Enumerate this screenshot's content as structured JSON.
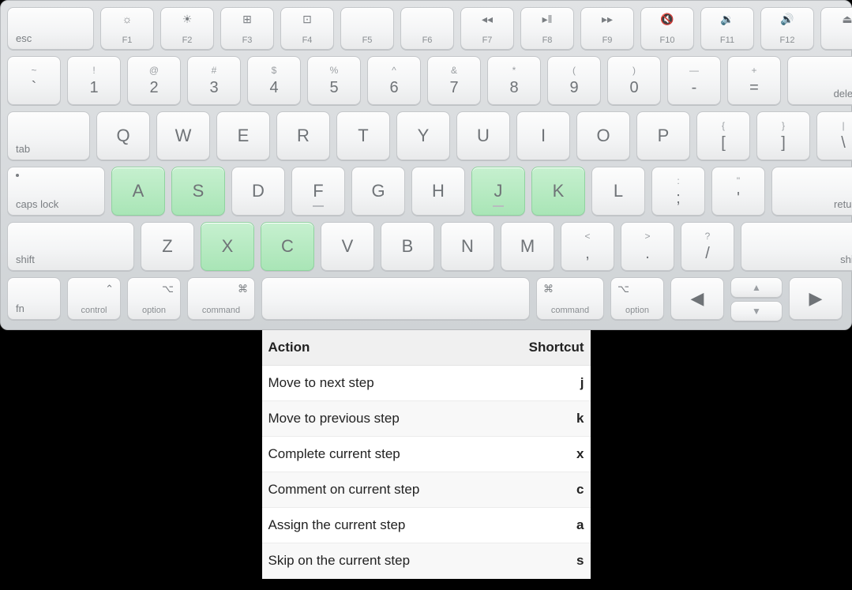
{
  "highlighted_keys": [
    "A",
    "S",
    "J",
    "K",
    "X",
    "C"
  ],
  "keyboard": {
    "row_fn": [
      {
        "main": "esc",
        "align": "bl"
      },
      {
        "glyph": "☼",
        "sub": "F1"
      },
      {
        "glyph": "☀",
        "sub": "F2"
      },
      {
        "glyph": "⊞",
        "sub": "F3"
      },
      {
        "glyph": "⊡",
        "sub": "F4"
      },
      {
        "glyph": "",
        "sub": "F5"
      },
      {
        "glyph": "",
        "sub": "F6"
      },
      {
        "glyph": "◂◂",
        "sub": "F7"
      },
      {
        "glyph": "▸‖",
        "sub": "F8"
      },
      {
        "glyph": "▸▸",
        "sub": "F9"
      },
      {
        "glyph": "🔇",
        "sub": "F10"
      },
      {
        "glyph": "🔉",
        "sub": "F11"
      },
      {
        "glyph": "🔊",
        "sub": "F12"
      },
      {
        "glyph": "⏏",
        "sub": ""
      }
    ],
    "row_num": [
      {
        "top": "~",
        "main": "`"
      },
      {
        "top": "!",
        "main": "1"
      },
      {
        "top": "@",
        "main": "2"
      },
      {
        "top": "#",
        "main": "3"
      },
      {
        "top": "$",
        "main": "4"
      },
      {
        "top": "%",
        "main": "5"
      },
      {
        "top": "^",
        "main": "6"
      },
      {
        "top": "&",
        "main": "7"
      },
      {
        "top": "*",
        "main": "8"
      },
      {
        "top": "(",
        "main": "9"
      },
      {
        "top": ")",
        "main": "0"
      },
      {
        "top": "—",
        "main": "-"
      },
      {
        "top": "+",
        "main": "="
      },
      {
        "main": "delete",
        "align": "br"
      }
    ],
    "row_q": [
      {
        "main": "tab",
        "align": "bl"
      },
      {
        "main": "Q"
      },
      {
        "main": "W"
      },
      {
        "main": "E"
      },
      {
        "main": "R"
      },
      {
        "main": "T"
      },
      {
        "main": "Y"
      },
      {
        "main": "U"
      },
      {
        "main": "I"
      },
      {
        "main": "O"
      },
      {
        "main": "P"
      },
      {
        "top": "{",
        "main": "["
      },
      {
        "top": "}",
        "main": "]"
      },
      {
        "top": "|",
        "main": "\\"
      }
    ],
    "row_a": [
      {
        "main": "caps lock",
        "align": "bl"
      },
      {
        "main": "A"
      },
      {
        "main": "S"
      },
      {
        "main": "D"
      },
      {
        "main": "F",
        "underline": true
      },
      {
        "main": "G"
      },
      {
        "main": "H"
      },
      {
        "main": "J",
        "underline": true
      },
      {
        "main": "K"
      },
      {
        "main": "L"
      },
      {
        "top": ":",
        "main": ";"
      },
      {
        "top": "\"",
        "main": "'"
      },
      {
        "main": "return",
        "align": "br"
      }
    ],
    "row_z": [
      {
        "main": "shift",
        "align": "bl"
      },
      {
        "main": "Z"
      },
      {
        "main": "X"
      },
      {
        "main": "C"
      },
      {
        "main": "V"
      },
      {
        "main": "B"
      },
      {
        "main": "N"
      },
      {
        "main": "M"
      },
      {
        "top": "<",
        "main": ","
      },
      {
        "top": ">",
        "main": "."
      },
      {
        "top": "?",
        "main": "/"
      },
      {
        "main": "shift",
        "align": "br"
      }
    ],
    "row_mod": [
      {
        "main": "fn",
        "align": "bl"
      },
      {
        "glyph": "⌃",
        "main": "control",
        "align": "bc"
      },
      {
        "glyph": "⌥",
        "main": "option",
        "align": "bc"
      },
      {
        "glyph": "⌘",
        "main": "command",
        "align": "bc"
      },
      {
        "main": " "
      },
      {
        "glyph": "⌘",
        "main": "command",
        "align": "bc",
        "gpos": "tl"
      },
      {
        "glyph": "⌥",
        "main": "option",
        "align": "bc",
        "gpos": "tl"
      },
      {
        "main": "◀"
      },
      {
        "split": true,
        "up": "▲",
        "down": "▼"
      },
      {
        "main": "▶"
      }
    ]
  },
  "shortcuts": {
    "header_action": "Action",
    "header_key": "Shortcut",
    "rows": [
      {
        "action": "Move to next step",
        "key": "j"
      },
      {
        "action": "Move to previous step",
        "key": "k"
      },
      {
        "action": "Complete current step",
        "key": "x"
      },
      {
        "action": "Comment on current step",
        "key": "c"
      },
      {
        "action": "Assign the current step",
        "key": "a"
      },
      {
        "action": "Skip on the current step",
        "key": "s"
      }
    ]
  }
}
